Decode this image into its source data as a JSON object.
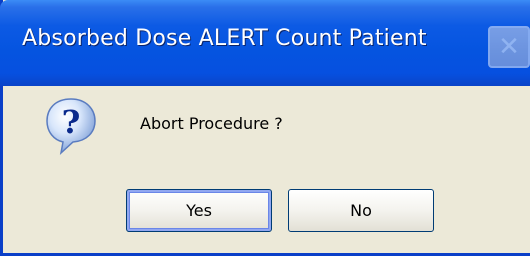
{
  "dialog": {
    "title": "Absorbed Dose ALERT  Count Patient",
    "close_symbol": "✕",
    "icon": "question-icon",
    "message": "Abort Procedure ?",
    "buttons": {
      "yes_label": "Yes",
      "no_label": "No"
    }
  },
  "colors": {
    "titlebar": "#0554e0",
    "face": "#ece9d8",
    "button_border": "#003c74"
  }
}
